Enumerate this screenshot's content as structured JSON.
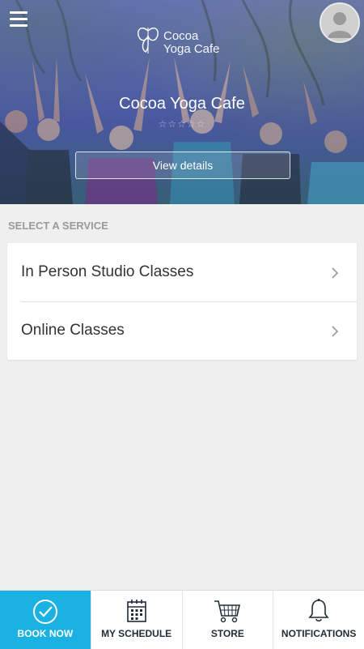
{
  "header": {
    "logo_line1": "Cocoa",
    "logo_line2": "Yoga Cafe",
    "studio_name": "Cocoa Yoga Cafe",
    "rating_stars": 0,
    "rating_max": 5,
    "view_details_label": "View details"
  },
  "icons": {
    "menu": "hamburger-menu-icon",
    "avatar": "user-avatar-icon",
    "chevron": "chevron-right-icon",
    "star": "star-icon"
  },
  "services": {
    "section_title": "SELECT A SERVICE",
    "items": [
      {
        "label": "In Person Studio Classes"
      },
      {
        "label": "Online Classes"
      }
    ]
  },
  "tabbar": {
    "tabs": [
      {
        "label": "BOOK NOW",
        "icon": "checkmark-circle-icon",
        "active": true
      },
      {
        "label": "MY SCHEDULE",
        "icon": "calendar-icon",
        "active": false
      },
      {
        "label": "STORE",
        "icon": "cart-icon",
        "active": false
      },
      {
        "label": "NOTIFICATIONS",
        "icon": "bell-icon",
        "active": false
      }
    ]
  },
  "colors": {
    "accent": "#1ab2e3",
    "background": "#efefef",
    "text_dark": "#333333",
    "section_title": "#9a9a9a"
  }
}
